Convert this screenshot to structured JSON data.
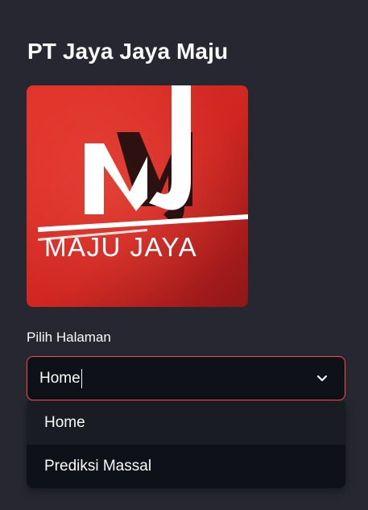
{
  "sidebar": {
    "title": "PT Jaya Jaya Maju",
    "logo": {
      "text": "MAJU JAYA",
      "background_color": "#d62a24",
      "accent_color": "#ffffff"
    },
    "select": {
      "label": "Pilih Halaman",
      "value": "Home",
      "border_color": "#ff4b4b",
      "options": [
        "Home",
        "Prediksi Massal"
      ]
    }
  }
}
